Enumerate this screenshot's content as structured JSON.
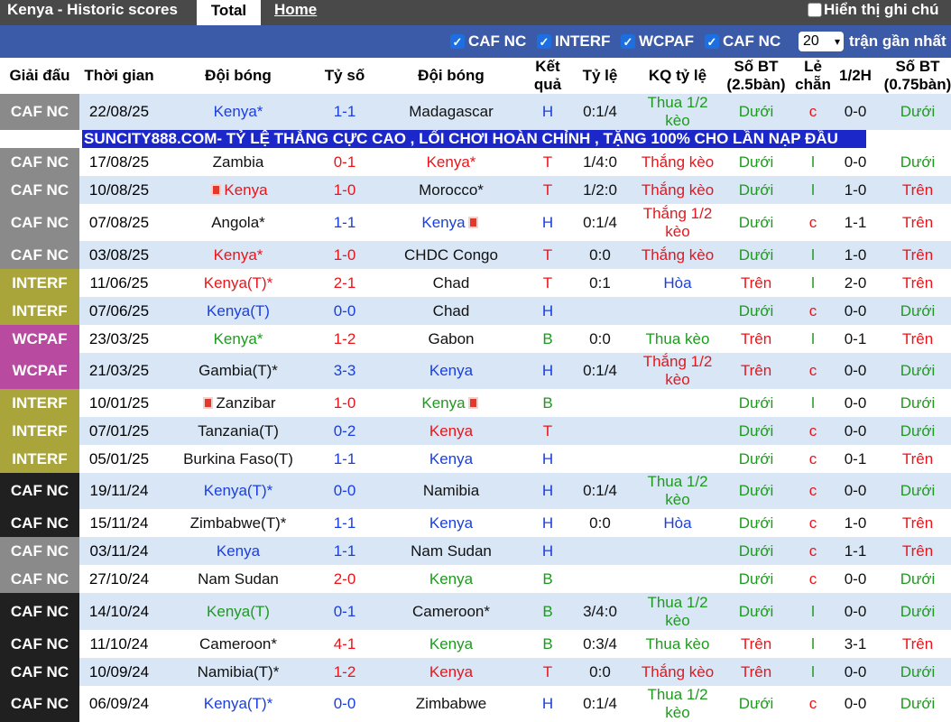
{
  "header": {
    "title": "Kenya - Historic scores",
    "tab_total": "Total",
    "tab_home": "Home",
    "show_note_label": "Hiển thị ghi chú"
  },
  "filters": {
    "items": [
      "CAF NC",
      "INTERF",
      "WCPAF",
      "CAF NC"
    ],
    "count_value": "20",
    "recent_label": "trận gần nhất"
  },
  "columns": {
    "league": "Giải đấu",
    "time": "Thời gian",
    "home_team": "Đội bóng",
    "score": "Tỷ số",
    "away_team": "Đội bóng",
    "result": "Kết quả",
    "odds": "Tỷ lệ",
    "odds_result": "KQ tỷ lệ",
    "goals_25": "Số BT (2.5bàn)",
    "odd_even": "Lẻ chẵn",
    "half": "1/2H",
    "goals_075": "Số BT (0.75bàn)"
  },
  "banner": "SUNCITY888.COM- TỶ LỆ THẮNG CỰC CAO , LỐI CHƠI HOÀN CHỈNH , TẶNG 100% CHO LẦN NẠP ĐẦU",
  "colors": {
    "caf_nc": "#202020",
    "caf_nc_grey": "#8a8a8a",
    "interf": "#a9a53a",
    "wcpaf": "#b84aa0",
    "row_light": "#d8e6f6",
    "row_white": "#ffffff",
    "banner_bg": "#1b27c9",
    "filter_bar": "#3b5ba9"
  },
  "rows": [
    {
      "league": "CAF NC",
      "date": "22/08/25",
      "home": "Kenya*",
      "score": "1-1",
      "away": "Madagascar",
      "result": "H",
      "odds": "0:1/4",
      "odds_result": "Thua 1/2 kèo",
      "goals25": "Dưới",
      "oe": "c",
      "half": "0-0",
      "goals075": "Dưới"
    },
    {
      "league": "CAF NC",
      "date": "17/08/25",
      "home": "Zambia",
      "score": "0-1",
      "away": "Kenya*",
      "result": "T",
      "odds": "1/4:0",
      "odds_result": "Thắng kèo",
      "goals25": "Dưới",
      "oe": "l",
      "half": "0-0",
      "goals075": "Dưới"
    },
    {
      "league": "CAF NC",
      "date": "10/08/25",
      "home": "Kenya",
      "score": "1-0",
      "away": "Morocco*",
      "result": "T",
      "odds": "1/2:0",
      "odds_result": "Thắng kèo",
      "goals25": "Dưới",
      "oe": "l",
      "half": "1-0",
      "goals075": "Trên"
    },
    {
      "league": "CAF NC",
      "date": "07/08/25",
      "home": "Angola*",
      "score": "1-1",
      "away": "Kenya",
      "result": "H",
      "odds": "0:1/4",
      "odds_result": "Thắng 1/2 kèo",
      "goals25": "Dưới",
      "oe": "c",
      "half": "1-1",
      "goals075": "Trên"
    },
    {
      "league": "CAF NC",
      "date": "03/08/25",
      "home": "Kenya*",
      "score": "1-0",
      "away": "CHDC Congo",
      "result": "T",
      "odds": "0:0",
      "odds_result": "Thắng kèo",
      "goals25": "Dưới",
      "oe": "l",
      "half": "1-0",
      "goals075": "Trên"
    },
    {
      "league": "INTERF",
      "date": "11/06/25",
      "home": "Kenya(T)*",
      "score": "2-1",
      "away": "Chad",
      "result": "T",
      "odds": "0:1",
      "odds_result": "Hòa",
      "goals25": "Trên",
      "oe": "l",
      "half": "2-0",
      "goals075": "Trên"
    },
    {
      "league": "INTERF",
      "date": "07/06/25",
      "home": "Kenya(T)",
      "score": "0-0",
      "away": "Chad",
      "result": "H",
      "odds": "",
      "odds_result": "",
      "goals25": "Dưới",
      "oe": "c",
      "half": "0-0",
      "goals075": "Dưới"
    },
    {
      "league": "WCPAF",
      "date": "23/03/25",
      "home": "Kenya*",
      "score": "1-2",
      "away": "Gabon",
      "result": "B",
      "odds": "0:0",
      "odds_result": "Thua kèo",
      "goals25": "Trên",
      "oe": "l",
      "half": "0-1",
      "goals075": "Trên"
    },
    {
      "league": "WCPAF",
      "date": "21/03/25",
      "home": "Gambia(T)*",
      "score": "3-3",
      "away": "Kenya",
      "result": "H",
      "odds": "0:1/4",
      "odds_result": "Thắng 1/2 kèo",
      "goals25": "Trên",
      "oe": "c",
      "half": "0-0",
      "goals075": "Dưới"
    },
    {
      "league": "INTERF",
      "date": "10/01/25",
      "home": "Zanzibar",
      "score": "1-0",
      "away": "Kenya",
      "result": "B",
      "odds": "",
      "odds_result": "",
      "goals25": "Dưới",
      "oe": "l",
      "half": "0-0",
      "goals075": "Dưới"
    },
    {
      "league": "INTERF",
      "date": "07/01/25",
      "home": "Tanzania(T)",
      "score": "0-2",
      "away": "Kenya",
      "result": "T",
      "odds": "",
      "odds_result": "",
      "goals25": "Dưới",
      "oe": "c",
      "half": "0-0",
      "goals075": "Dưới"
    },
    {
      "league": "INTERF",
      "date": "05/01/25",
      "home": "Burkina Faso(T)",
      "score": "1-1",
      "away": "Kenya",
      "result": "H",
      "odds": "",
      "odds_result": "",
      "goals25": "Dưới",
      "oe": "c",
      "half": "0-1",
      "goals075": "Trên"
    },
    {
      "league": "CAF NC",
      "date": "19/11/24",
      "home": "Kenya(T)*",
      "score": "0-0",
      "away": "Namibia",
      "result": "H",
      "odds": "0:1/4",
      "odds_result": "Thua 1/2 kèo",
      "goals25": "Dưới",
      "oe": "c",
      "half": "0-0",
      "goals075": "Dưới"
    },
    {
      "league": "CAF NC",
      "date": "15/11/24",
      "home": "Zimbabwe(T)*",
      "score": "1-1",
      "away": "Kenya",
      "result": "H",
      "odds": "0:0",
      "odds_result": "Hòa",
      "goals25": "Dưới",
      "oe": "c",
      "half": "1-0",
      "goals075": "Trên"
    },
    {
      "league": "CAF NC",
      "date": "03/11/24",
      "home": "Kenya",
      "score": "1-1",
      "away": "Nam Sudan",
      "result": "H",
      "odds": "",
      "odds_result": "",
      "goals25": "Dưới",
      "oe": "c",
      "half": "1-1",
      "goals075": "Trên"
    },
    {
      "league": "CAF NC",
      "date": "27/10/24",
      "home": "Nam Sudan",
      "score": "2-0",
      "away": "Kenya",
      "result": "B",
      "odds": "",
      "odds_result": "",
      "goals25": "Dưới",
      "oe": "c",
      "half": "0-0",
      "goals075": "Dưới"
    },
    {
      "league": "CAF NC",
      "date": "14/10/24",
      "home": "Kenya(T)",
      "score": "0-1",
      "away": "Cameroon*",
      "result": "B",
      "odds": "3/4:0",
      "odds_result": "Thua 1/2 kèo",
      "goals25": "Dưới",
      "oe": "l",
      "half": "0-0",
      "goals075": "Dưới"
    },
    {
      "league": "CAF NC",
      "date": "11/10/24",
      "home": "Cameroon*",
      "score": "4-1",
      "away": "Kenya",
      "result": "B",
      "odds": "0:3/4",
      "odds_result": "Thua kèo",
      "goals25": "Trên",
      "oe": "l",
      "half": "3-1",
      "goals075": "Trên"
    },
    {
      "league": "CAF NC",
      "date": "10/09/24",
      "home": "Namibia(T)*",
      "score": "1-2",
      "away": "Kenya",
      "result": "T",
      "odds": "0:0",
      "odds_result": "Thắng kèo",
      "goals25": "Trên",
      "oe": "l",
      "half": "0-0",
      "goals075": "Dưới"
    },
    {
      "league": "CAF NC",
      "date": "06/09/24",
      "home": "Kenya(T)*",
      "score": "0-0",
      "away": "Zimbabwe",
      "result": "H",
      "odds": "0:1/4",
      "odds_result": "Thua 1/2 kèo",
      "goals25": "Dưới",
      "oe": "c",
      "half": "0-0",
      "goals075": "Dưới"
    }
  ]
}
